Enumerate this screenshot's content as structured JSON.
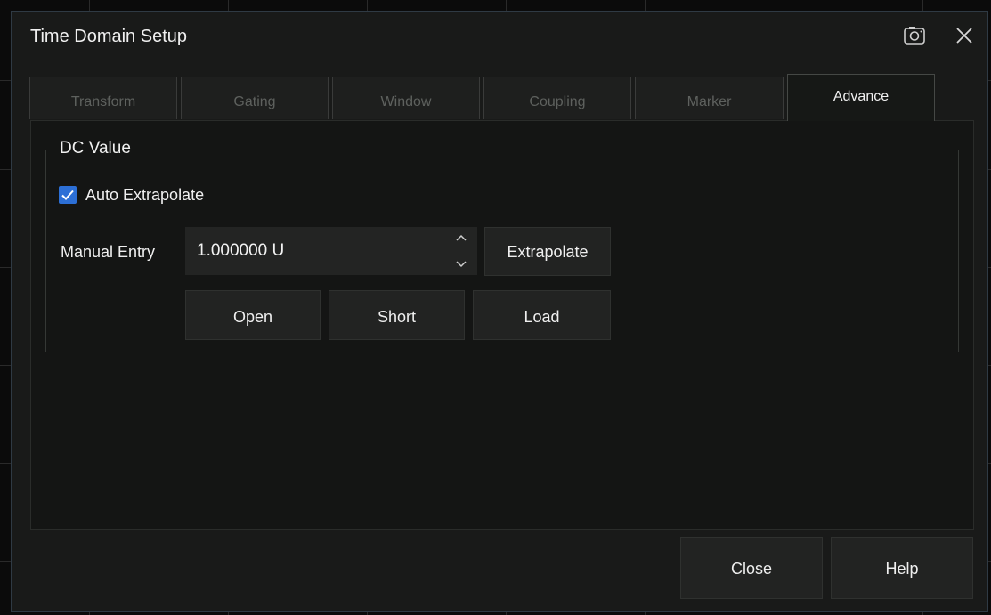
{
  "dialog": {
    "title": "Time Domain Setup",
    "camera_icon": "camera-icon",
    "close_icon": "close-icon"
  },
  "tabs": [
    {
      "label": "Transform",
      "active": false
    },
    {
      "label": "Gating",
      "active": false
    },
    {
      "label": "Window",
      "active": false
    },
    {
      "label": "Coupling",
      "active": false
    },
    {
      "label": "Marker",
      "active": false
    },
    {
      "label": "Advance",
      "active": true
    }
  ],
  "dc_value": {
    "legend": "DC Value",
    "auto_extrapolate": {
      "label": "Auto Extrapolate",
      "checked": true
    },
    "manual_entry": {
      "label": "Manual Entry",
      "value": "1.000000 U"
    },
    "extrapolate_button": "Extrapolate",
    "standards": {
      "open": "Open",
      "short": "Short",
      "load": "Load"
    }
  },
  "footer": {
    "close_label": "Close",
    "help_label": "Help"
  },
  "colors": {
    "accent": "#2c6fd6",
    "dialog_bg": "#191a19",
    "panel_bg": "#141514"
  }
}
